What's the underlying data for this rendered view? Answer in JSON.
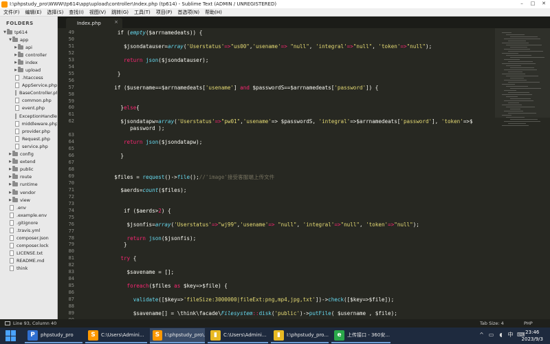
{
  "window": {
    "title": "I:\\phpstudy_pro\\WWW\\tp614\\app\\upload\\controller\\Index.php (tp614) - Sublime Text (ADMIN / UNREGISTERED)"
  },
  "menu": [
    "文件(F)",
    "编辑(E)",
    "选择(S)",
    "查找(I)",
    "视图(V)",
    "跳转(G)",
    "工具(T)",
    "项目(P)",
    "首选项(N)",
    "帮助(H)"
  ],
  "sidebar": {
    "header": "FOLDERS",
    "items": [
      {
        "label": "tp614",
        "type": "folder",
        "depth": 0,
        "open": true
      },
      {
        "label": "app",
        "type": "folder",
        "depth": 1,
        "open": true
      },
      {
        "label": "api",
        "type": "folder",
        "depth": 2,
        "open": false
      },
      {
        "label": "controller",
        "type": "folder",
        "depth": 2,
        "open": false
      },
      {
        "label": "index",
        "type": "folder",
        "depth": 2,
        "open": false
      },
      {
        "label": "upload",
        "type": "folder",
        "depth": 2,
        "open": false
      },
      {
        "label": ".htaccess",
        "type": "file",
        "depth": 2
      },
      {
        "label": "AppService.php",
        "type": "file",
        "depth": 2
      },
      {
        "label": "BaseController.php",
        "type": "file",
        "depth": 2
      },
      {
        "label": "common.php",
        "type": "file",
        "depth": 2
      },
      {
        "label": "event.php",
        "type": "file",
        "depth": 2
      },
      {
        "label": "ExceptionHandle.php",
        "type": "file",
        "depth": 2
      },
      {
        "label": "middleware.php",
        "type": "file",
        "depth": 2
      },
      {
        "label": "provider.php",
        "type": "file",
        "depth": 2
      },
      {
        "label": "Request.php",
        "type": "file",
        "depth": 2
      },
      {
        "label": "service.php",
        "type": "file",
        "depth": 2
      },
      {
        "label": "config",
        "type": "folder",
        "depth": 1,
        "open": false
      },
      {
        "label": "extend",
        "type": "folder",
        "depth": 1,
        "open": false
      },
      {
        "label": "public",
        "type": "folder",
        "depth": 1,
        "open": false
      },
      {
        "label": "route",
        "type": "folder",
        "depth": 1,
        "open": false
      },
      {
        "label": "runtime",
        "type": "folder",
        "depth": 1,
        "open": false
      },
      {
        "label": "vendor",
        "type": "folder",
        "depth": 1,
        "open": false
      },
      {
        "label": "view",
        "type": "folder",
        "depth": 1,
        "open": false
      },
      {
        "label": ".env",
        "type": "file",
        "depth": 1
      },
      {
        "label": ".example.env",
        "type": "file",
        "depth": 1
      },
      {
        "label": ".gitignore",
        "type": "file",
        "depth": 1
      },
      {
        "label": ".travis.yml",
        "type": "file",
        "depth": 1
      },
      {
        "label": "composer.json",
        "type": "file",
        "depth": 1
      },
      {
        "label": "composer.lock",
        "type": "file",
        "depth": 1
      },
      {
        "label": "LICENSE.txt",
        "type": "file",
        "depth": 1
      },
      {
        "label": "README.md",
        "type": "file",
        "depth": 1
      },
      {
        "label": "think",
        "type": "file",
        "depth": 1
      }
    ]
  },
  "tab": {
    "label": "Index.php",
    "close": "×"
  },
  "editor": {
    "line_numbers": [
      "49",
      "50",
      "51",
      "52",
      "53",
      "54",
      "55",
      "56",
      "57",
      "58",
      "59",
      "60",
      "61",
      "62",
      "",
      "63",
      "64",
      "65",
      "66",
      "67",
      "68",
      "69",
      "70",
      "71",
      "72",
      "73",
      "74",
      "75",
      "76",
      "77",
      "78",
      "79",
      "80",
      "81",
      "82",
      "83",
      "84",
      "85",
      "86",
      "87",
      "88",
      "89",
      "90",
      "91"
    ],
    "code_lines": [
      {
        "indent": 12,
        "tokens": [
          [
            "if (",
            "var"
          ],
          [
            "empty",
            "it"
          ],
          [
            "($arrnamedeats)) {",
            "var"
          ]
        ]
      },
      {
        "indent": 0,
        "tokens": []
      },
      {
        "indent": 14,
        "tokens": [
          [
            "$jsondatauser=",
            "var"
          ],
          [
            "array",
            "it"
          ],
          [
            "(",
            "var"
          ],
          [
            "'Userstatus'",
            "str"
          ],
          [
            "=>",
            "kw"
          ],
          [
            "\"us00\"",
            "str"
          ],
          [
            ",",
            "var"
          ],
          [
            "'usename'",
            "str"
          ],
          [
            "=> ",
            "kw"
          ],
          [
            "\"null\"",
            "str"
          ],
          [
            ", ",
            "var"
          ],
          [
            "'integral'",
            "str"
          ],
          [
            "=>",
            "kw"
          ],
          [
            "\"null\"",
            "str"
          ],
          [
            ", ",
            "var"
          ],
          [
            "'token'",
            "str"
          ],
          [
            "=>",
            "kw"
          ],
          [
            "\"null\"",
            "str"
          ],
          [
            ");",
            "var"
          ]
        ]
      },
      {
        "indent": 0,
        "tokens": []
      },
      {
        "indent": 14,
        "tokens": [
          [
            "return ",
            "kw"
          ],
          [
            "json",
            "fn"
          ],
          [
            "($jsondatauser);",
            "var"
          ]
        ]
      },
      {
        "indent": 0,
        "tokens": []
      },
      {
        "indent": 12,
        "tokens": [
          [
            "}",
            "var"
          ]
        ]
      },
      {
        "indent": 0,
        "tokens": []
      },
      {
        "indent": 11,
        "tokens": [
          [
            "if ($username==$arrnamedeats[",
            "var"
          ],
          [
            "'usename'",
            "str"
          ],
          [
            "] ",
            "var"
          ],
          [
            "and",
            "kw"
          ],
          [
            " $passwordS==$arrnamedeats[",
            "var"
          ],
          [
            "'password'",
            "str"
          ],
          [
            "]) {",
            "var"
          ]
        ]
      },
      {
        "indent": 0,
        "tokens": []
      },
      {
        "indent": 0,
        "tokens": []
      },
      {
        "indent": 13,
        "tokens": [
          [
            "}",
            "var"
          ],
          [
            "else",
            "kw"
          ],
          [
            "{",
            "var"
          ]
        ]
      },
      {
        "indent": 0,
        "tokens": []
      },
      {
        "indent": 13,
        "tokens": [
          [
            "$jsondatapw=",
            "var"
          ],
          [
            "array",
            "it"
          ],
          [
            "(",
            "var"
          ],
          [
            "'Userstatus'",
            "str"
          ],
          [
            "=>",
            "kw"
          ],
          [
            "\"pw01\"",
            "str"
          ],
          [
            ",",
            "var"
          ],
          [
            "'usename'",
            "str"
          ],
          [
            "=> $passwordS, ",
            "var"
          ],
          [
            "'integral'",
            "str"
          ],
          [
            "=>$arrnamedeats[",
            "var"
          ],
          [
            "'password'",
            "str"
          ],
          [
            "], ",
            "var"
          ],
          [
            "'token'",
            "str"
          ],
          [
            "=>$",
            "var"
          ]
        ]
      },
      {
        "indent": 16,
        "tokens": [
          [
            "password );",
            "var"
          ]
        ]
      },
      {
        "indent": 0,
        "tokens": []
      },
      {
        "indent": 14,
        "tokens": [
          [
            "return ",
            "kw"
          ],
          [
            "json",
            "fn"
          ],
          [
            "($jsondatapw);",
            "var"
          ]
        ]
      },
      {
        "indent": 0,
        "tokens": []
      },
      {
        "indent": 13,
        "tokens": [
          [
            "}",
            "var"
          ]
        ]
      },
      {
        "indent": 0,
        "tokens": []
      },
      {
        "indent": 0,
        "tokens": []
      },
      {
        "indent": 11,
        "tokens": [
          [
            "$files = ",
            "var"
          ],
          [
            "request",
            "fn"
          ],
          [
            "()->",
            "var"
          ],
          [
            "file",
            "fn"
          ],
          [
            "();",
            "var"
          ],
          [
            "//'image'接受客服端上传文件",
            "cm"
          ]
        ]
      },
      {
        "indent": 0,
        "tokens": []
      },
      {
        "indent": 13,
        "tokens": [
          [
            "$aerds=",
            "var"
          ],
          [
            "count",
            "it"
          ],
          [
            "($files);",
            "var"
          ]
        ]
      },
      {
        "indent": 0,
        "tokens": []
      },
      {
        "indent": 0,
        "tokens": []
      },
      {
        "indent": 14,
        "tokens": [
          [
            "if ($aerds>",
            "var"
          ],
          [
            "2",
            "kw"
          ],
          [
            ") {",
            "var"
          ]
        ]
      },
      {
        "indent": 0,
        "tokens": []
      },
      {
        "indent": 15,
        "tokens": [
          [
            "$jsonfis=",
            "var"
          ],
          [
            "array",
            "it"
          ],
          [
            "(",
            "var"
          ],
          [
            "'Userstatus'",
            "str"
          ],
          [
            "=>",
            "kw"
          ],
          [
            "\"wj99\"",
            "str"
          ],
          [
            ",",
            "var"
          ],
          [
            "'usename'",
            "str"
          ],
          [
            "=> ",
            "kw"
          ],
          [
            "\"null\"",
            "str"
          ],
          [
            ", ",
            "var"
          ],
          [
            "'integral'",
            "str"
          ],
          [
            "=>",
            "kw"
          ],
          [
            "\"null\"",
            "str"
          ],
          [
            ", ",
            "var"
          ],
          [
            "'token'",
            "str"
          ],
          [
            "=>",
            "kw"
          ],
          [
            "\"null\"",
            "str"
          ],
          [
            ");",
            "var"
          ]
        ]
      },
      {
        "indent": 0,
        "tokens": []
      },
      {
        "indent": 15,
        "tokens": [
          [
            "return ",
            "kw"
          ],
          [
            "json",
            "fn"
          ],
          [
            "($jsonfis);",
            "var"
          ]
        ]
      },
      {
        "indent": 14,
        "tokens": [
          [
            "}",
            "var"
          ]
        ]
      },
      {
        "indent": 0,
        "tokens": []
      },
      {
        "indent": 13,
        "tokens": [
          [
            "try",
            "kw"
          ],
          [
            " {",
            "var"
          ]
        ]
      },
      {
        "indent": 0,
        "tokens": []
      },
      {
        "indent": 15,
        "tokens": [
          [
            "$savename = [];",
            "var"
          ]
        ]
      },
      {
        "indent": 0,
        "tokens": []
      },
      {
        "indent": 15,
        "tokens": [
          [
            "foreach",
            "kw"
          ],
          [
            "($files ",
            "var"
          ],
          [
            "as",
            "kw"
          ],
          [
            " $key=>$file) {",
            "var"
          ]
        ]
      },
      {
        "indent": 0,
        "tokens": []
      },
      {
        "indent": 17,
        "tokens": [
          [
            "validate",
            "fn"
          ],
          [
            "([$key=>",
            "var"
          ],
          [
            "'fileSize:3000000|fileExt:png,mp4,jpg,txt'",
            "str"
          ],
          [
            "])->",
            "var"
          ],
          [
            "check",
            "fn"
          ],
          [
            "([$key=>$file]);",
            "var"
          ]
        ]
      },
      {
        "indent": 0,
        "tokens": []
      },
      {
        "indent": 17,
        "tokens": [
          [
            "$savename[] = \\think\\facade\\",
            "var"
          ],
          [
            "Filesystem",
            "it"
          ],
          [
            "::",
            "kw"
          ],
          [
            "disk",
            "fn"
          ],
          [
            "(",
            "var"
          ],
          [
            "'public'",
            "str"
          ],
          [
            ")->",
            "var"
          ],
          [
            "putFile",
            "fn"
          ],
          [
            "( $username , $file);",
            "var"
          ]
        ]
      },
      {
        "indent": 0,
        "tokens": []
      }
    ]
  },
  "status": {
    "position": "Line 93, Column 40",
    "tab_size": "Tab Size: 4",
    "syntax": "PHP"
  },
  "taskbar": {
    "tasks": [
      {
        "label": "phpstudy_pro",
        "color": "#2f6fd0",
        "glyph": "P"
      },
      {
        "label": "C:\\Users\\Admini...",
        "color": "#ff9800",
        "glyph": "S"
      },
      {
        "label": "I:\\phpstudy_pro\\...",
        "color": "#ff9800",
        "glyph": "S"
      },
      {
        "label": "C:\\Users\\Admini...",
        "color": "#e8b923",
        "glyph": "▮"
      },
      {
        "label": "I:\\phpstudy_pro...",
        "color": "#e8b923",
        "glyph": "▮"
      },
      {
        "label": "上传接口 - 360安...",
        "color": "#2aa84a",
        "glyph": "e"
      }
    ],
    "clock_time": "23:46",
    "clock_date": "2023/9/3"
  },
  "colors": {
    "editor_bg": "#272822",
    "keyword": "#f92672",
    "string": "#e6db74",
    "function": "#66d9ef",
    "comment": "#75715e"
  }
}
